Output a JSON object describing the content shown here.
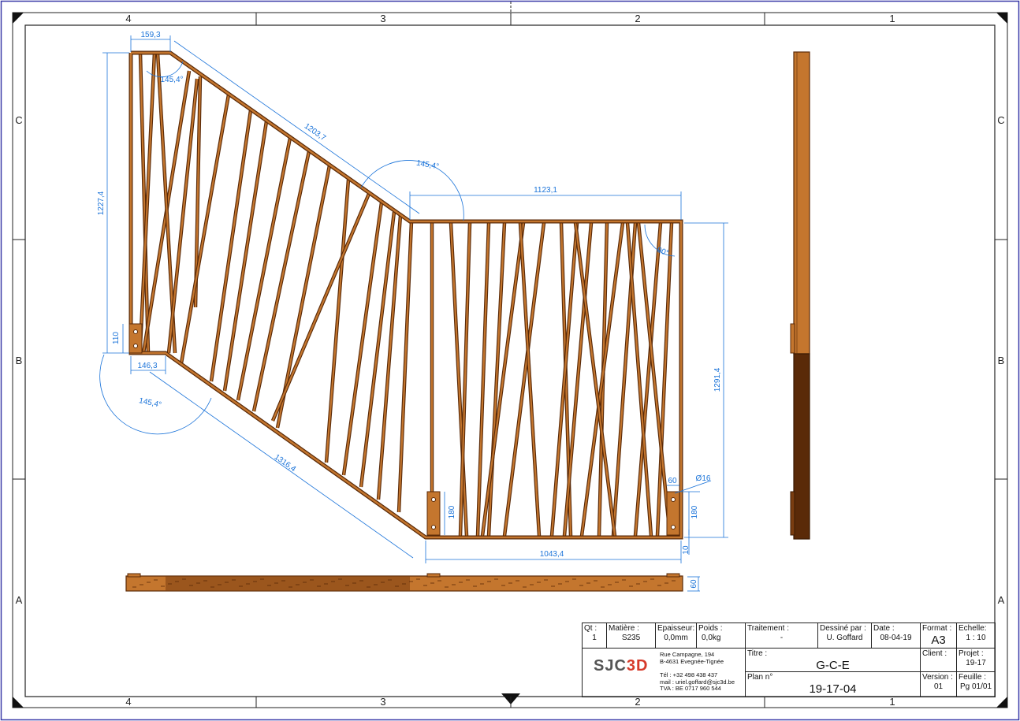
{
  "sheet": {
    "zone_columns_top": [
      "4",
      "3",
      "2",
      "1"
    ],
    "zone_columns_bottom": [
      "4",
      "3",
      "2",
      "1"
    ],
    "zone_rows_left": [
      "C",
      "B",
      "A"
    ],
    "zone_rows_right": [
      "C",
      "B",
      "A"
    ]
  },
  "dimensions": {
    "top_width": "159,3",
    "top_angle": "145,4°",
    "slope_top": "1203,7",
    "angle_mid": "145,4°",
    "right_top_width": "1123,1",
    "left_height": "1227,4",
    "corner_angle": "90°",
    "plate_height_left": "110",
    "bottom_left_width": "146,3",
    "angle_bottom": "145,4°",
    "slope_bottom": "1316,4",
    "right_height": "1291,4",
    "plate_width": "60",
    "hole_diameter": "Ø16",
    "plate_height_mid": "180",
    "plate_height_right": "180",
    "bottom_width": "1043,4",
    "bottom_offset": "10",
    "thickness": "60"
  },
  "title_block": {
    "qty_label": "Qt :",
    "qty_value": "1",
    "material_label": "Matière :",
    "material_value": "S235",
    "thickness_label": "Epaisseur:",
    "thickness_value": "0,0mm",
    "weight_label": "Poids :",
    "weight_value": "0,0kg",
    "treatment_label": "Traitement :",
    "treatment_value": "-",
    "drawn_by_label": "Dessiné par :",
    "drawn_by_value": "U. Goffard",
    "date_label": "Date :",
    "date_value": "08-04-19",
    "format_label": "Format :",
    "format_value": "A3",
    "scale_label": "Echelle:",
    "scale_value": "1 : 10",
    "logo_left": "SJC",
    "logo_right": "3D",
    "address_line1": "Rue Campagne, 194",
    "address_line2": "B-4631 Evegnée-Tignée",
    "phone": "Tél : +32 498 438 437",
    "mail": "mail : uriel.goffard@sjc3d.be",
    "vat": "TVA : BE 0717 960 544",
    "title_label": "Titre :",
    "title_value": "G-C-E",
    "client_label": "Client :",
    "client_value": "",
    "project_label": "Projet :",
    "project_value": "19-17",
    "plan_label": "Plan n°",
    "plan_value": "19-17-04",
    "version_label": "Version :",
    "version_value": "01",
    "sheet_label": "Feuille :",
    "sheet_value": "Pg  01/01"
  },
  "colors": {
    "frame": "#222222",
    "dimension": "#1a73d9",
    "wood": "#c4762e",
    "wood_dark": "#7a3d10",
    "wood_edge": "#5a2a08"
  }
}
